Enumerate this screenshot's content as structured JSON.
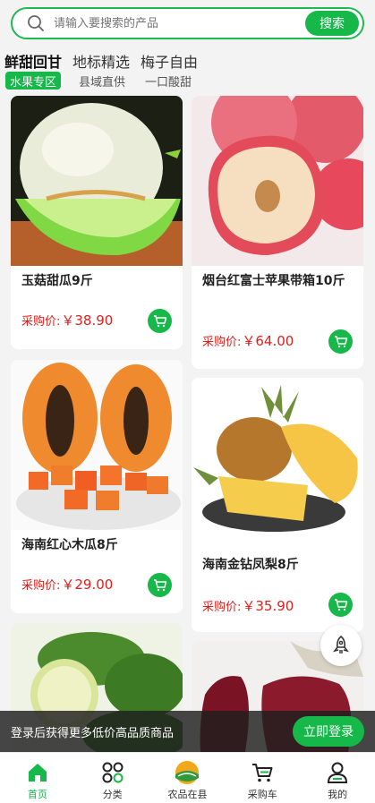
{
  "search": {
    "placeholder": "请输入要搜索的产品",
    "button": "搜索"
  },
  "categories": [
    "鲜甜回甘",
    "地标精选",
    "梅子自由"
  ],
  "sub_tabs": [
    "水果专区",
    "县域直供",
    "一口酸甜"
  ],
  "products": [
    {
      "name": "玉菇甜瓜9斤",
      "price_label": "采购价:",
      "price": "￥38.90"
    },
    {
      "name": "烟台红富士苹果带箱10斤",
      "price_label": "采购价:",
      "price": "￥64.00"
    },
    {
      "name": "海南红心木瓜8斤",
      "price_label": "采购价:",
      "price": "￥29.00"
    },
    {
      "name": "海南金钻凤梨8斤",
      "price_label": "采购价:",
      "price": "￥35.90"
    }
  ],
  "login_banner": {
    "text": "登录后获得更多低价高品质商品",
    "button": "立即登录"
  },
  "nav": [
    "首页",
    "分类",
    "农品在县",
    "采购车",
    "我的"
  ],
  "colors": {
    "accent": "#17b84a",
    "price": "#e0201c"
  }
}
